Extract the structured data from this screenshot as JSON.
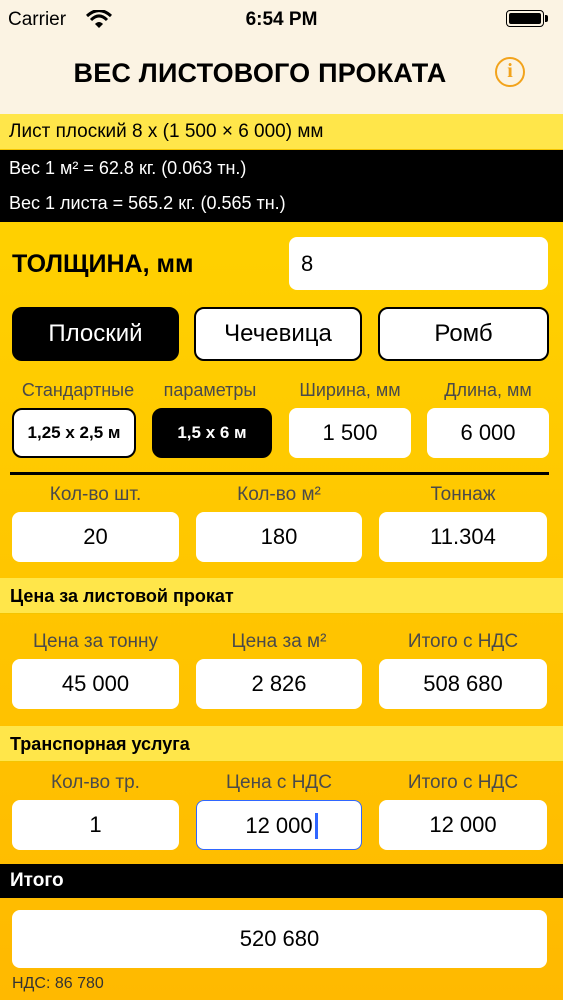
{
  "status_bar": {
    "carrier": "Carrier",
    "time": "6:54 PM"
  },
  "nav": {
    "title": "ВЕС ЛИСТОВОГО ПРОКАТА",
    "info_icon": "info-icon"
  },
  "summary": {
    "sheet_desc": "Лист плоский 8 х (1 500 × 6 000) мм",
    "weight_m2": "Вес 1 м² = 62.8 кг. (0.063 тн.)",
    "weight_sheet": "Вес 1 листа = 565.2 кг. (0.565 тн.)"
  },
  "thickness": {
    "label": "ТОЛЩИНА, мм",
    "value": "8"
  },
  "types": [
    {
      "label": "Плоский",
      "selected": true
    },
    {
      "label": "Чечевица",
      "selected": false
    },
    {
      "label": "Ромб",
      "selected": false
    }
  ],
  "dimensions": {
    "standard_label": "Стандартные",
    "params_label": "параметры",
    "width_label": "Ширина, мм",
    "length_label": "Длина, мм",
    "standard_options": [
      {
        "label": "1,25 х 2,5 м",
        "selected": false
      },
      {
        "label": "1,5 х 6 м",
        "selected": true
      }
    ],
    "width_value": "1 500",
    "length_value": "6 000"
  },
  "quantity": {
    "count_label": "Кол-во шт.",
    "count_value": "20",
    "area_label": "Кол-во м²",
    "area_value": "180",
    "tonnage_label": "Тоннаж",
    "tonnage_value": "11.304"
  },
  "price": {
    "header": "Цена за листовой прокат",
    "per_ton_label": "Цена за тонну",
    "per_ton_value": "45 000",
    "per_m2_label": "Цена за м²",
    "per_m2_value": "2 826",
    "total_label": "Итого с НДС",
    "total_value": "508 680"
  },
  "transport": {
    "header": "Транспорная услуга",
    "count_label": "Кол-во тр.",
    "count_value": "1",
    "price_label": "Цена с НДС",
    "price_value": "12 000",
    "total_label": "Итого с НДС",
    "total_value": "12 000"
  },
  "total": {
    "header": "Итого",
    "value": "520 680",
    "vat": "НДС: 86 780"
  },
  "colors": {
    "accent": "#f2a31c",
    "background": "#ffd200",
    "nav_bg": "#fbf3e3",
    "cursor": "#2f66ff"
  }
}
